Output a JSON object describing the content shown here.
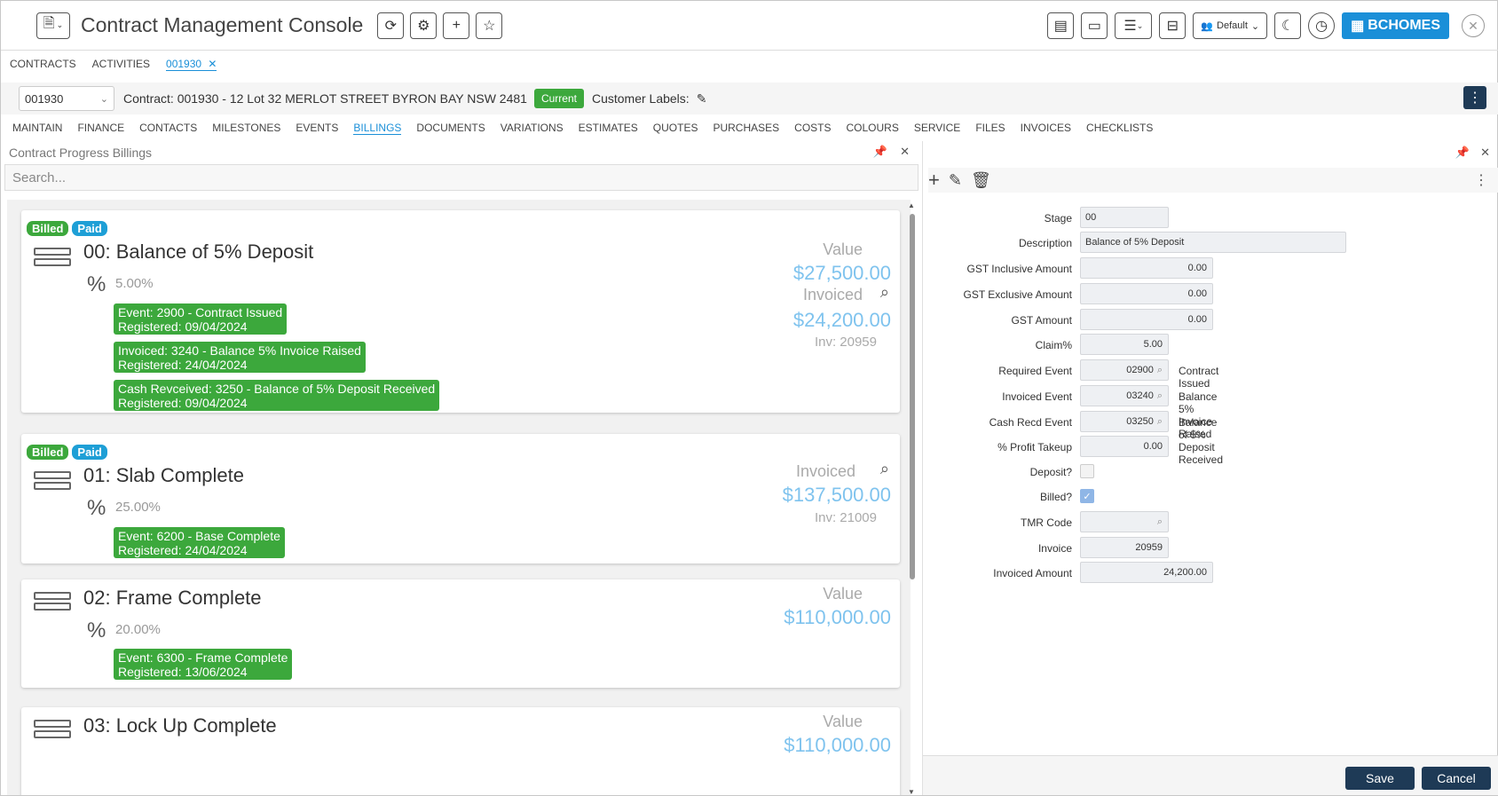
{
  "app": {
    "title": "Contract Management Console",
    "profile_label": "Default",
    "brand_label": "BCHOMES"
  },
  "top_tabs": [
    {
      "label": "CONTRACTS"
    },
    {
      "label": "ACTIVITIES"
    },
    {
      "label": "001930"
    }
  ],
  "contract": {
    "selected": "001930",
    "text": "Contract: 001930 - 12 Lot 32 MERLOT STREET BYRON BAY NSW 2481",
    "status": "Current",
    "customer_labels": "Customer Labels:"
  },
  "sub_tabs": [
    "MAINTAIN",
    "FINANCE",
    "CONTACTS",
    "MILESTONES",
    "EVENTS",
    "BILLINGS",
    "DOCUMENTS",
    "VARIATIONS",
    "ESTIMATES",
    "QUOTES",
    "PURCHASES",
    "COSTS",
    "COLOURS",
    "SERVICE",
    "FILES",
    "INVOICES",
    "CHECKLISTS"
  ],
  "active_sub_tab": "BILLINGS",
  "left_pane": {
    "title": "Contract Progress Billings",
    "search_placeholder": "Search...",
    "cards": [
      {
        "badges": [
          "Billed",
          "Paid"
        ],
        "title": "00: Balance of 5% Deposit",
        "percent": "5.00%",
        "events": [
          {
            "line1": "Event: 2900 - Contract Issued",
            "line2": "Registered: 09/04/2024"
          },
          {
            "line1": "Invoiced: 3240 - Balance 5% Invoice Raised",
            "line2": "Registered: 24/04/2024"
          },
          {
            "line1": "Cash Revceived: 3250 - Balance of 5% Deposit Received",
            "line2": "Registered: 09/04/2024"
          }
        ],
        "value_label": "Value",
        "value": "$27,500.00",
        "invoiced_label": "Invoiced",
        "invoiced": "$24,200.00",
        "inv_no": "Inv: 20959"
      },
      {
        "badges": [
          "Billed",
          "Paid"
        ],
        "title": "01: Slab Complete",
        "percent": "25.00%",
        "events": [
          {
            "line1": "Event: 6200 - Base Complete",
            "line2": "Registered: 24/04/2024"
          }
        ],
        "invoiced_label": "Invoiced",
        "invoiced": "$137,500.00",
        "inv_no": "Inv: 21009"
      },
      {
        "title": "02: Frame Complete",
        "percent": "20.00%",
        "events": [
          {
            "line1": "Event: 6300 - Frame Complete",
            "line2": "Registered: 13/06/2024"
          }
        ],
        "value_label": "Value",
        "value": "$110,000.00"
      },
      {
        "title": "03: Lock Up Complete",
        "value_label": "Value",
        "value": "$110,000.00"
      }
    ]
  },
  "form": {
    "stage": {
      "label": "Stage",
      "value": "00"
    },
    "description": {
      "label": "Description",
      "value": "Balance of 5% Deposit"
    },
    "gst_inclusive": {
      "label": "GST Inclusive Amount",
      "value": "0.00"
    },
    "gst_exclusive": {
      "label": "GST Exclusive Amount",
      "value": "0.00"
    },
    "gst_amount": {
      "label": "GST Amount",
      "value": "0.00"
    },
    "claim": {
      "label": "Claim%",
      "value": "5.00"
    },
    "required_event": {
      "label": "Required Event",
      "value": "02900",
      "desc": "Contract Issued"
    },
    "invoiced_event": {
      "label": "Invoiced Event",
      "value": "03240",
      "desc": "Balance 5% Invoice Raised"
    },
    "cash_recd_event": {
      "label": "Cash Recd Event",
      "value": "03250",
      "desc": "Balance of 5% Deposit Received"
    },
    "profit_takeup": {
      "label": "% Profit Takeup",
      "value": "0.00"
    },
    "deposit": {
      "label": "Deposit?",
      "checked": false
    },
    "billed": {
      "label": "Billed?",
      "checked": true
    },
    "tmr_code": {
      "label": "TMR Code",
      "value": ""
    },
    "invoice": {
      "label": "Invoice",
      "value": "20959"
    },
    "invoiced_amount": {
      "label": "Invoiced Amount",
      "value": "24,200.00"
    }
  },
  "footer": {
    "save": "Save",
    "cancel": "Cancel"
  },
  "colors": {
    "accent": "#1a8fd8",
    "success": "#3ca83c",
    "paid": "#1e9fd6",
    "dark_button": "#1e3a56",
    "value_blue": "#7fc3ee"
  }
}
